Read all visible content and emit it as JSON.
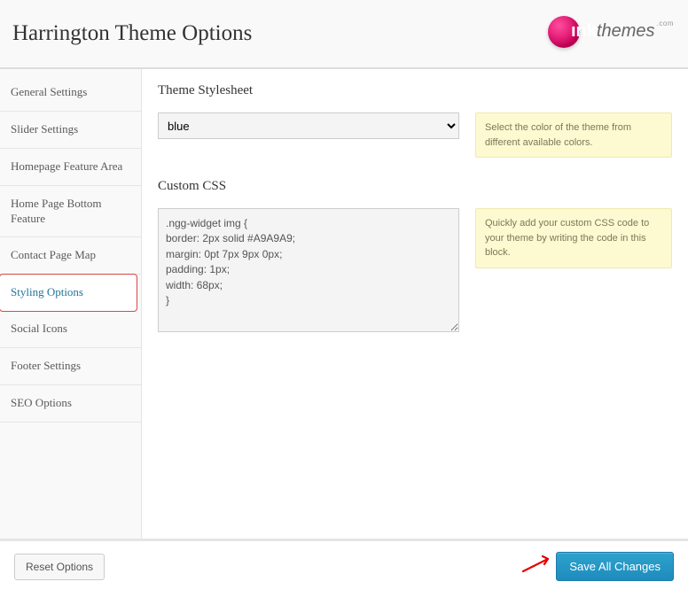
{
  "header": {
    "title": "Harrington Theme Options",
    "logo_ink": "ınk",
    "logo_themes": "themes",
    "logo_com": ".com"
  },
  "sidebar": {
    "items": [
      {
        "label": "General Settings"
      },
      {
        "label": "Slider Settings"
      },
      {
        "label": "Homepage Feature Area"
      },
      {
        "label": "Home Page Bottom Feature"
      },
      {
        "label": "Contact Page Map"
      },
      {
        "label": "Styling Options"
      },
      {
        "label": "Social Icons"
      },
      {
        "label": "Footer Settings"
      },
      {
        "label": "SEO Options"
      }
    ],
    "active_index": 5
  },
  "content": {
    "stylesheet": {
      "label": "Theme Stylesheet",
      "value": "blue",
      "help": "Select the color of the theme from different available colors."
    },
    "custom_css": {
      "label": "Custom CSS",
      "value": ".ngg-widget img {\nborder: 2px solid #A9A9A9;\nmargin: 0pt 7px 9px 0px;\npadding: 1px;\nwidth: 68px;\n}",
      "help": "Quickly add your custom CSS code to your theme by writing the code in this block."
    }
  },
  "footer": {
    "reset_label": "Reset Options",
    "save_label": "Save All Changes"
  }
}
